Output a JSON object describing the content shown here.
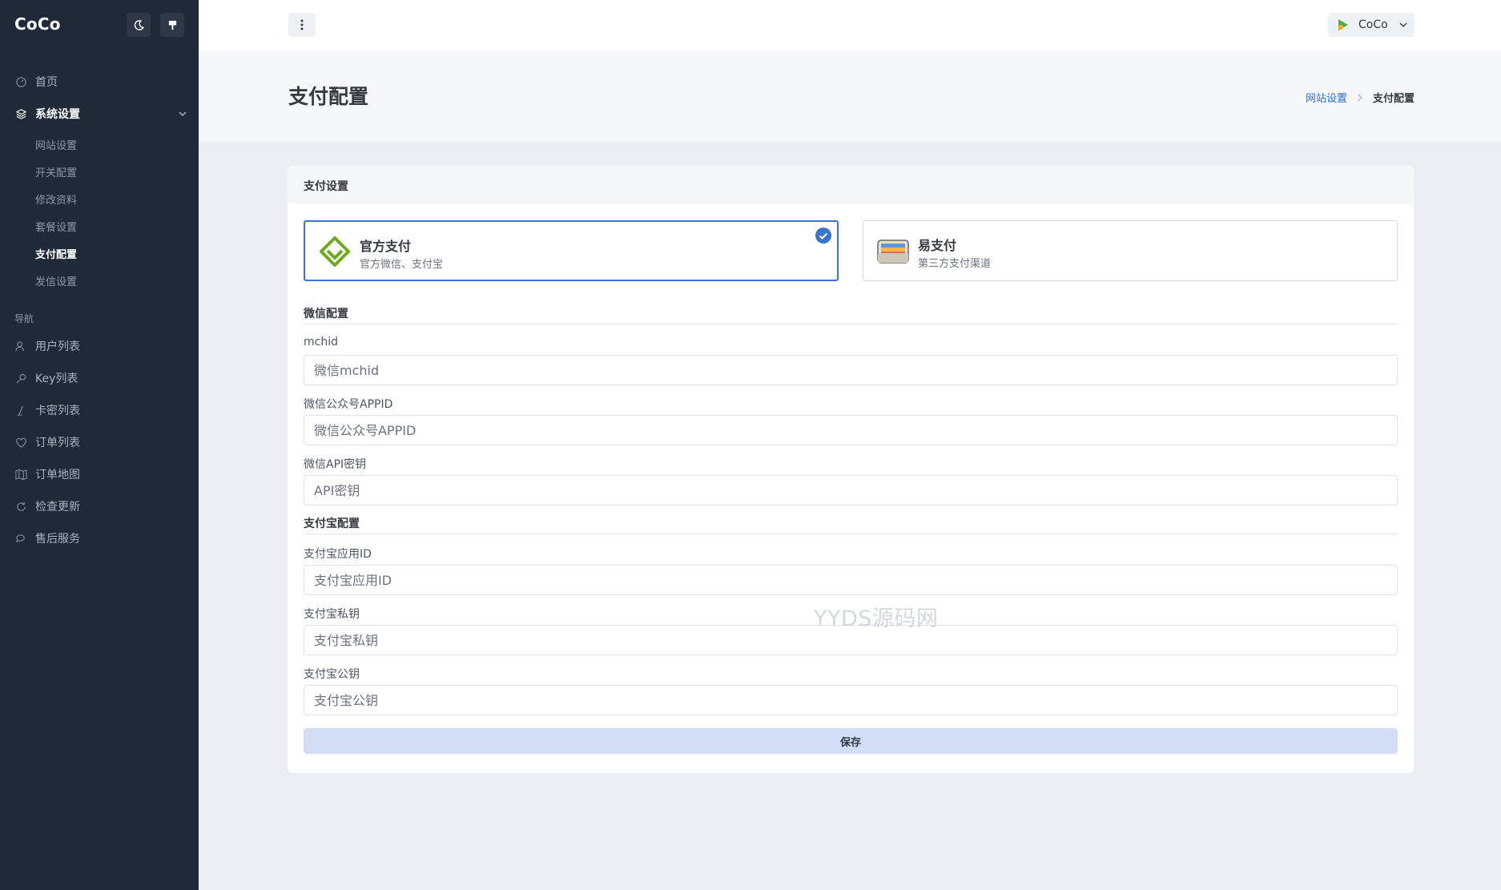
{
  "app": {
    "brand": "CoCo"
  },
  "sidebar": {
    "home": "首页",
    "system": {
      "label": "系统设置",
      "children": [
        "网站设置",
        "开关配置",
        "修改资料",
        "套餐设置",
        "支付配置",
        "发信设置"
      ],
      "active_child": "支付配置"
    },
    "section_label": "导航",
    "nav": [
      {
        "label": "用户列表",
        "icon": "users-icon"
      },
      {
        "label": "Key列表",
        "icon": "key-icon"
      },
      {
        "label": "卡密列表",
        "icon": "card-icon"
      },
      {
        "label": "订单列表",
        "icon": "heart-icon"
      },
      {
        "label": "订单地图",
        "icon": "map-icon"
      },
      {
        "label": "检查更新",
        "icon": "refresh-icon"
      },
      {
        "label": "售后服务",
        "icon": "chat-icon"
      }
    ]
  },
  "topbar": {
    "user_name": "CoCo"
  },
  "page": {
    "title": "支付配置",
    "breadcrumb": {
      "parent": "网站设置",
      "current": "支付配置"
    }
  },
  "card": {
    "title": "支付设置",
    "options": [
      {
        "name": "官方支付",
        "desc": "官方微信、支付宝",
        "selected": true
      },
      {
        "name": "易支付",
        "desc": "第三方支付渠道",
        "selected": false
      }
    ],
    "wechat": {
      "title": "微信配置",
      "fields": [
        {
          "label": "mchid",
          "placeholder": "微信mchid"
        },
        {
          "label": "微信公众号APPID",
          "placeholder": "微信公众号APPID"
        },
        {
          "label": "微信API密钥",
          "placeholder": "API密钥"
        }
      ]
    },
    "alipay": {
      "title": "支付宝配置",
      "fields": [
        {
          "label": "支付宝应用ID",
          "placeholder": "支付宝应用ID"
        },
        {
          "label": "支付宝私钥",
          "placeholder": "支付宝私钥"
        },
        {
          "label": "支付宝公钥",
          "placeholder": "支付宝公钥"
        }
      ]
    },
    "save_label": "保存"
  },
  "watermark": "YYDS源码网",
  "colors": {
    "sidebar_bg": "#1f2937",
    "accent": "#3b73d1",
    "save_bg": "#d1def6"
  }
}
